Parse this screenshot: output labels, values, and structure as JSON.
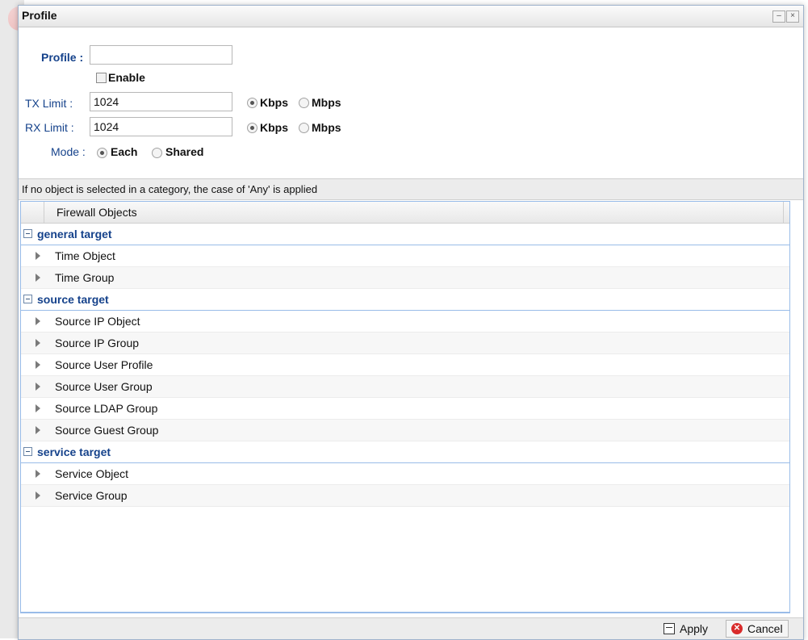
{
  "window": {
    "title": "Profile",
    "minimize_glyph": "–",
    "close_glyph": "×"
  },
  "form": {
    "profile_label": "Profile :",
    "profile_value": "",
    "enable_label": "Enable",
    "enable_checked": false,
    "tx_label": "TX Limit :",
    "tx_value": "1024",
    "rx_label": "RX Limit :",
    "rx_value": "1024",
    "unit_kbps": "Kbps",
    "unit_mbps": "Mbps",
    "tx_unit_selected": "Kbps",
    "rx_unit_selected": "Kbps",
    "mode_label": "Mode :",
    "mode_each": "Each",
    "mode_shared": "Shared",
    "mode_selected": "Each"
  },
  "info_text": "If no object is selected in a category, the case of 'Any' is applied",
  "grid": {
    "header": "Firewall Objects",
    "groups": [
      {
        "name": "general target",
        "items": [
          "Time Object",
          "Time Group"
        ]
      },
      {
        "name": "source target",
        "items": [
          "Source IP Object",
          "Source IP Group",
          "Source User Profile",
          "Source User Group",
          "Source LDAP Group",
          "Source Guest Group"
        ]
      },
      {
        "name": "service target",
        "items": [
          "Service Object",
          "Service Group"
        ]
      }
    ]
  },
  "footer": {
    "apply_label": "Apply",
    "cancel_label": "Cancel"
  },
  "colors": {
    "group_text": "#15428b",
    "grid_border": "#99bce8",
    "cancel_icon": "#d92b2b"
  }
}
